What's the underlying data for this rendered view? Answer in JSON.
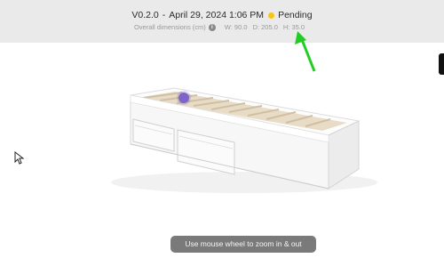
{
  "header": {
    "version": "V0.2.0",
    "date_separator": "-",
    "date": "April 29, 2024 1:06 PM",
    "status": "Pending",
    "status_color": "#f5c518",
    "dimensions_label": "Overall dimensions (cm)",
    "info_icon": "info-icon",
    "width": "W: 90.0",
    "depth": "D: 205.0",
    "height": "H: 35.0"
  },
  "viewer": {
    "hint": "Use mouse wheel to zoom in & out",
    "hotspot_color": "#7c64c8",
    "annotation_color": "#22cc22"
  }
}
